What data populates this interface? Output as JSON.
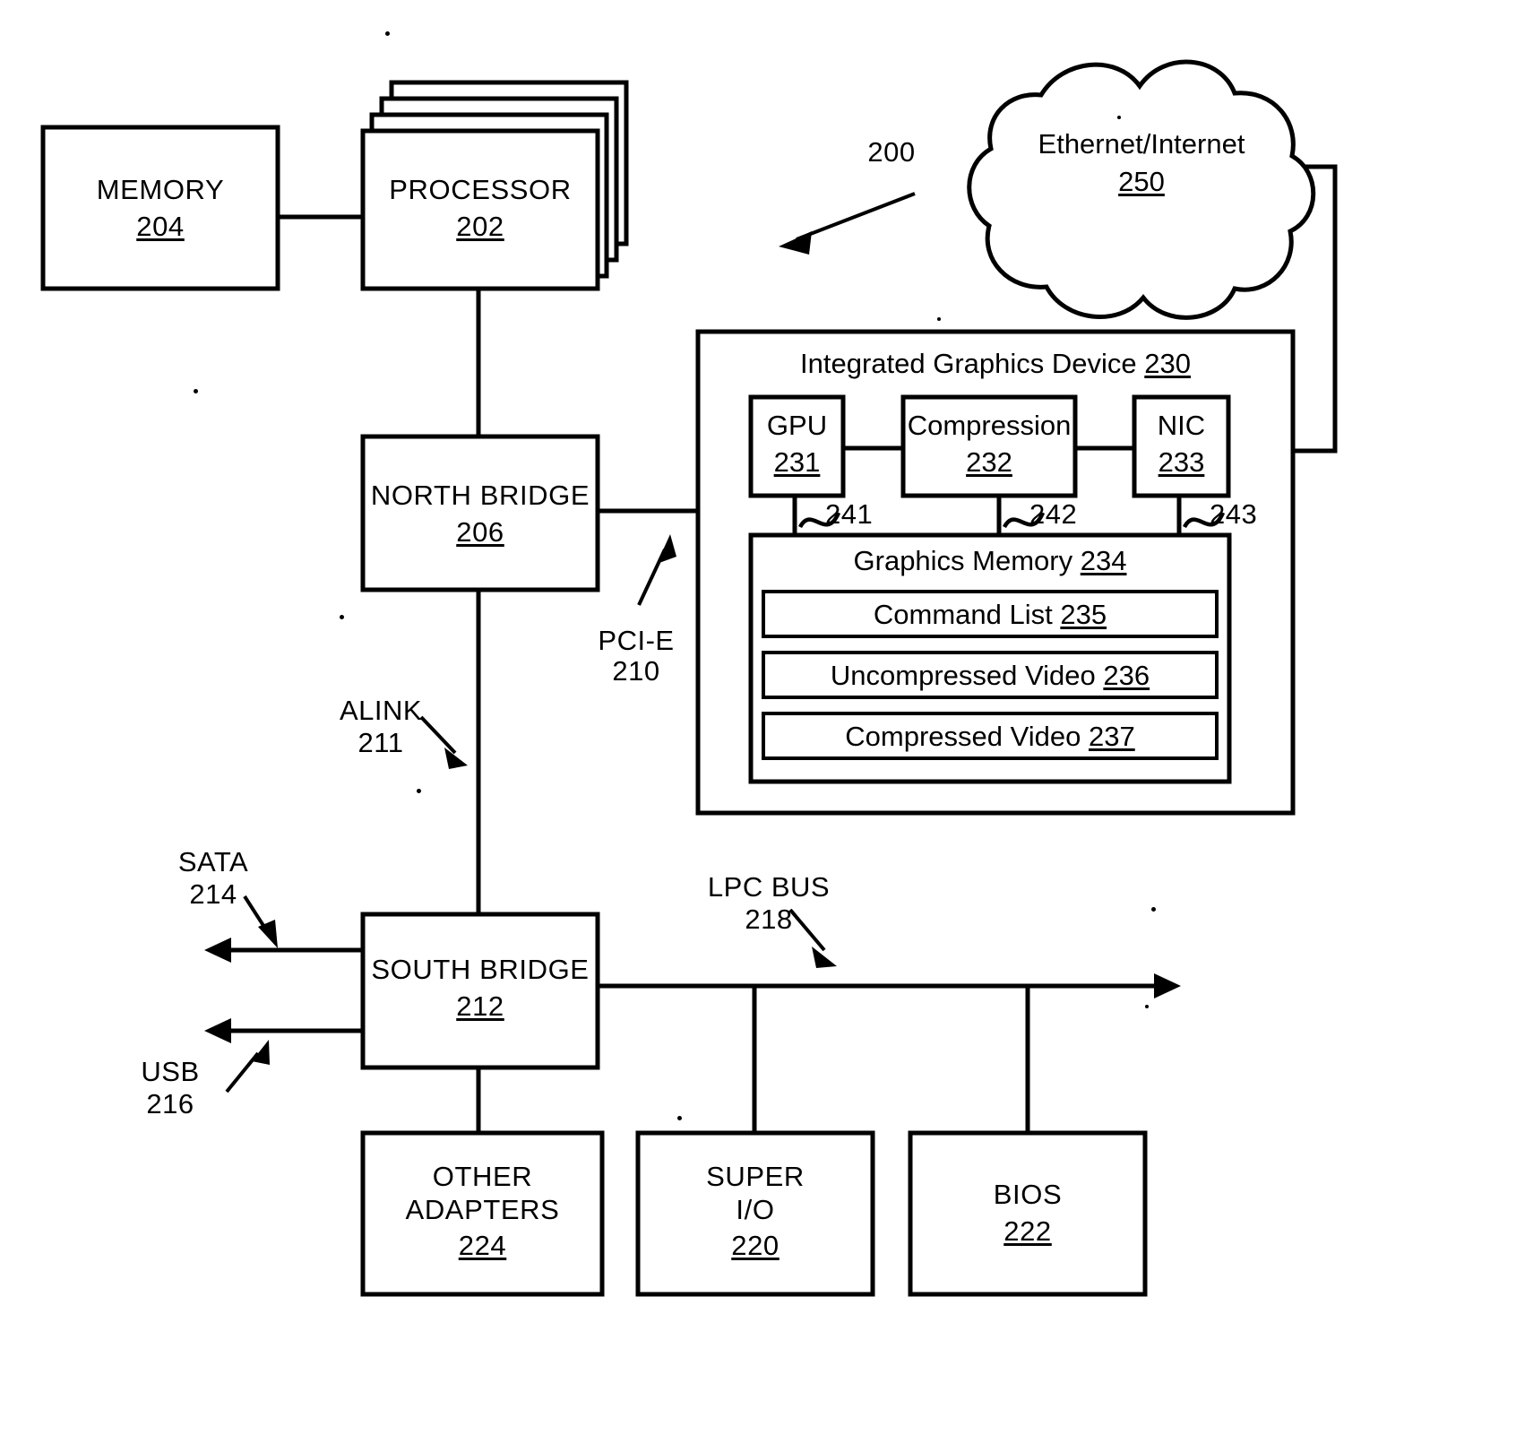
{
  "figure": {
    "reference": "200",
    "type": "patent-block-diagram"
  },
  "blocks": {
    "memory": {
      "label": "MEMORY",
      "ref": "204"
    },
    "processor": {
      "label": "PROCESSOR",
      "ref": "202"
    },
    "north_bridge": {
      "label": "NORTH BRIDGE",
      "ref": "206"
    },
    "south_bridge": {
      "label": "SOUTH BRIDGE",
      "ref": "212"
    },
    "other_adapters": {
      "label_line1": "OTHER",
      "label_line2": "ADAPTERS",
      "ref": "224"
    },
    "super_io": {
      "label_line1": "SUPER",
      "label_line2": "I/O",
      "ref": "220"
    },
    "bios": {
      "label": "BIOS",
      "ref": "222"
    },
    "igd": {
      "label": "Integrated Graphics Device",
      "ref": "230"
    },
    "gpu": {
      "label": "GPU",
      "ref": "231"
    },
    "compression": {
      "label": "Compression",
      "ref": "232"
    },
    "nic": {
      "label": "NIC",
      "ref": "233"
    },
    "graphics_memory": {
      "label": "Graphics Memory",
      "ref": "234"
    },
    "command_list": {
      "label": "Command List",
      "ref": "235"
    },
    "uncompressed_video": {
      "label": "Uncompressed Video",
      "ref": "236"
    },
    "compressed_video": {
      "label": "Compressed Video",
      "ref": "237"
    },
    "cloud": {
      "label": "Ethernet/Internet",
      "ref": "250"
    }
  },
  "bus_labels": {
    "pcie": {
      "name": "PCI-E",
      "ref": "210"
    },
    "alink": {
      "name": "ALINK",
      "ref": "211"
    },
    "sata": {
      "name": "SATA",
      "ref": "214"
    },
    "usb": {
      "name": "USB",
      "ref": "216"
    },
    "lpc": {
      "name": "LPC BUS",
      "ref": "218"
    }
  },
  "link_refs": {
    "gpu_to_gfxmem": "241",
    "compression_to_gfxmem": "242",
    "nic_to_gfxmem": "243"
  }
}
